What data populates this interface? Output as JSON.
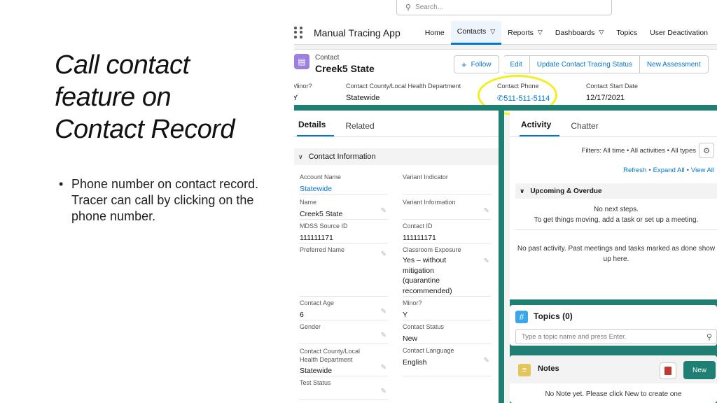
{
  "slide": {
    "title_lines": [
      "Call contact",
      "feature on",
      "Contact Record"
    ],
    "bullet": "Phone number on contact record. Tracer can call by clicking on the phone number."
  },
  "search": {
    "placeholder": "Search..."
  },
  "nav": {
    "app_name": "Manual Tracing App",
    "items": [
      "Home",
      "Contacts",
      "Reports",
      "Dashboards",
      "Topics",
      "User Deactivation"
    ]
  },
  "record": {
    "type": "Contact",
    "name": "Creek5 State",
    "actions": {
      "follow": "Follow",
      "edit": "Edit",
      "update": "Update Contact Tracing Status",
      "new_assessment": "New Assessment"
    },
    "highlights": {
      "minor_label": "Minor?",
      "minor_value": "Y",
      "county_label": "Contact County/Local Health Department",
      "county_value": "Statewide",
      "phone_label": "Contact Phone",
      "phone_value": "511-511-5114",
      "start_label": "Contact Start Date",
      "start_value": "12/17/2021"
    }
  },
  "details": {
    "tabs": [
      "Details",
      "Related"
    ],
    "section": "Contact Information",
    "fields": {
      "account_name_label": "Account Name",
      "account_name_value": "Statewide",
      "variant_indicator_label": "Variant Indicator",
      "name_label": "Name",
      "name_value": "Creek5 State",
      "variant_info_label": "Variant Information",
      "mdss_label": "MDSS Source ID",
      "mdss_value": "111111171",
      "contact_id_label": "Contact ID",
      "contact_id_value": "111111171",
      "preferred_label": "Preferred Name",
      "classroom_label": "Classroom Exposure",
      "classroom_value": "Yes – without mitigation (quarantine recommended)",
      "age_label": "Contact Age",
      "age_value": "6",
      "minor_label": "Minor?",
      "minor_value": "Y",
      "gender_label": "Gender",
      "status_label": "Contact Status",
      "status_value": "New",
      "county_label": "Contact County/Local Health Department",
      "county_value": "Statewide",
      "language_label": "Contact Language",
      "language_value": "English",
      "test_status_label": "Test Status"
    }
  },
  "activity": {
    "tabs": [
      "Activity",
      "Chatter"
    ],
    "filters": "Filters: All time • All activities • All types",
    "links": [
      "Refresh",
      "Expand All",
      "View All"
    ],
    "upcoming": "Upcoming & Overdue",
    "no_steps_1": "No next steps.",
    "no_steps_2": "To get things moving, add a task or set up a meeting.",
    "no_past": "No past activity. Past meetings and tasks marked as done show up here."
  },
  "topics": {
    "title": "Topics (0)",
    "placeholder": "Type a topic name and press Enter."
  },
  "notes": {
    "title": "Notes",
    "new_label": "New",
    "empty": "No Note yet. Please click New to create one"
  },
  "colors": {
    "accent": "#0176d3",
    "teal": "#1e7f72",
    "highlight": "#f2ef1e"
  }
}
